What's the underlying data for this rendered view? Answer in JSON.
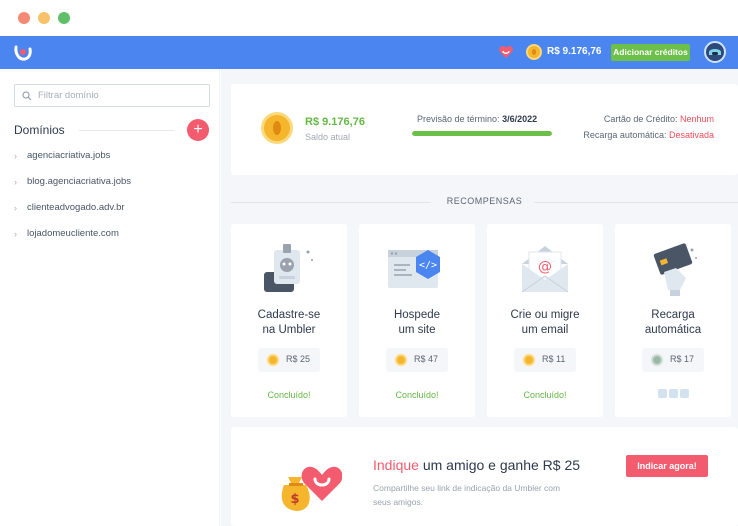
{
  "header": {
    "balance": "R$ 9.176,76",
    "add_credits_label": "Adicionar créditos"
  },
  "sidebar": {
    "search_placeholder": "Filtrar domínio",
    "title": "Domínios",
    "add_label": "+",
    "domains": [
      "agenciacriativa.jobs",
      "blog.agenciacriativa.jobs",
      "clienteadvogado.adv.br",
      "lojadomeucliente.com"
    ]
  },
  "balance_card": {
    "value": "R$ 9.176,76",
    "label": "Saldo atual",
    "forecast_label": "Previsão de término:",
    "forecast_date": "3/6/2022",
    "forecast_progress": 1.0,
    "credit_card_label": "Cartão de Crédito:",
    "credit_card_value": "Nenhum",
    "auto_recharge_label": "Recarga automática:",
    "auto_recharge_value": "Desativada"
  },
  "rewards": {
    "section_title": "RECOMPENSAS",
    "items": [
      {
        "line1": "Cadastre-se",
        "line2": "na Umbler",
        "price": "R$ 25",
        "status": "Concluído!",
        "icon": "badge-icon"
      },
      {
        "line1": "Hospede",
        "line2": "um site",
        "price": "R$ 47",
        "status": "Concluído!",
        "icon": "code-window-icon"
      },
      {
        "line1": "Crie ou migre",
        "line2": "um email",
        "price": "R$ 11",
        "status": "Concluído!",
        "icon": "envelope-icon"
      },
      {
        "line1": "Recarga",
        "line2": "automática",
        "price": "R$ 17",
        "status": "",
        "icon": "credit-card-icon"
      }
    ]
  },
  "refer": {
    "title_highlight": "Indique",
    "title_rest": " um amigo e ganhe R$ 25",
    "subtitle": "Compartilhe seu link de indicação da Umbler com seus amigos.",
    "button_label": "Indicar agora!"
  },
  "colors": {
    "topbar": "#4b85f0",
    "accent_green": "#6cc04a",
    "accent_red": "#f25c6e",
    "coin": "#f5b52d"
  }
}
